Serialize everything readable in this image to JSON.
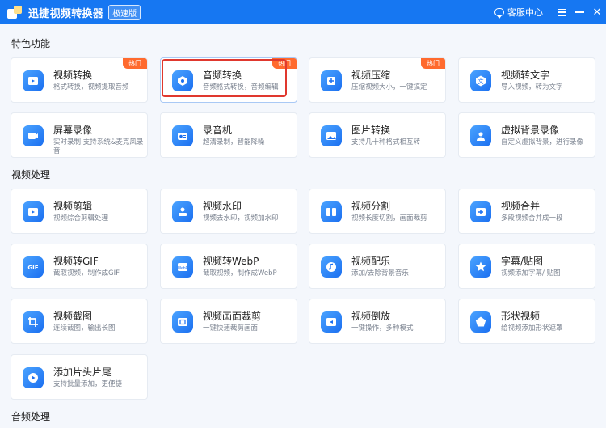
{
  "app": {
    "title": "迅捷视频转换器",
    "edition_badge": "极速版",
    "support_label": "客服中心"
  },
  "sections": [
    {
      "title": "特色功能"
    },
    {
      "title": "视频处理"
    },
    {
      "title": "音频处理"
    }
  ],
  "cards": [
    {
      "title": "视频转换",
      "desc": "格式转换，视频提取音频",
      "badge": "热门",
      "icon": "video-convert-icon"
    },
    {
      "title": "音频转换",
      "desc": "音频格式转换，音频编辑",
      "badge": "热门",
      "icon": "audio-convert-icon",
      "selected": true
    },
    {
      "title": "视频压缩",
      "desc": "压缩视频大小，一键搞定",
      "badge": "热门",
      "icon": "video-compress-icon"
    },
    {
      "title": "视频转文字",
      "desc": "导入视频，转为文字",
      "icon": "video-to-text-icon"
    },
    {
      "title": "屏幕录像",
      "desc": "实时录制 支持系统&麦克风录音",
      "icon": "screen-record-icon"
    },
    {
      "title": "录音机",
      "desc": "超清录制，智能降噪",
      "icon": "recorder-icon"
    },
    {
      "title": "图片转换",
      "desc": "支持几十种格式相互转",
      "icon": "image-convert-icon"
    },
    {
      "title": "虚拟背景录像",
      "desc": "自定义虚拟背景，进行录像",
      "icon": "virtual-bg-icon"
    },
    {
      "title": "视频剪辑",
      "desc": "视频综合剪辑处理",
      "icon": "video-edit-icon"
    },
    {
      "title": "视频水印",
      "desc": "视频去水印，视频加水印",
      "icon": "watermark-icon"
    },
    {
      "title": "视频分割",
      "desc": "视频长度切割，画面裁剪",
      "icon": "video-split-icon"
    },
    {
      "title": "视频合并",
      "desc": "多段视频合并成一段",
      "icon": "video-merge-icon"
    },
    {
      "title": "视频转GIF",
      "desc": "截取视频，制作成GIF",
      "icon": "gif-icon"
    },
    {
      "title": "视频转WebP",
      "desc": "截取视频，制作成WebP",
      "icon": "webp-icon"
    },
    {
      "title": "视频配乐",
      "desc": "添加/去除背景音乐",
      "icon": "music-icon"
    },
    {
      "title": "字幕/贴图",
      "desc": "视频添加字幕/ 贴图",
      "icon": "subtitle-icon"
    },
    {
      "title": "视频截图",
      "desc": "连续截图，输出长图",
      "icon": "screenshot-icon"
    },
    {
      "title": "视频画面裁剪",
      "desc": "一键快速裁剪画面",
      "icon": "crop-icon"
    },
    {
      "title": "视频倒放",
      "desc": "一键操作，多种模式",
      "icon": "reverse-icon"
    },
    {
      "title": "形状视频",
      "desc": "给视频添加形状遮罩",
      "icon": "shape-video-icon"
    },
    {
      "title": "添加片头片尾",
      "desc": "支持批量添加，更便捷",
      "icon": "intro-outro-icon"
    }
  ],
  "colors": {
    "titlebar": "#1677f2",
    "accent": "#1b6ff0",
    "hot_badge": "#ff6a2e",
    "selection": "#e0382e"
  }
}
